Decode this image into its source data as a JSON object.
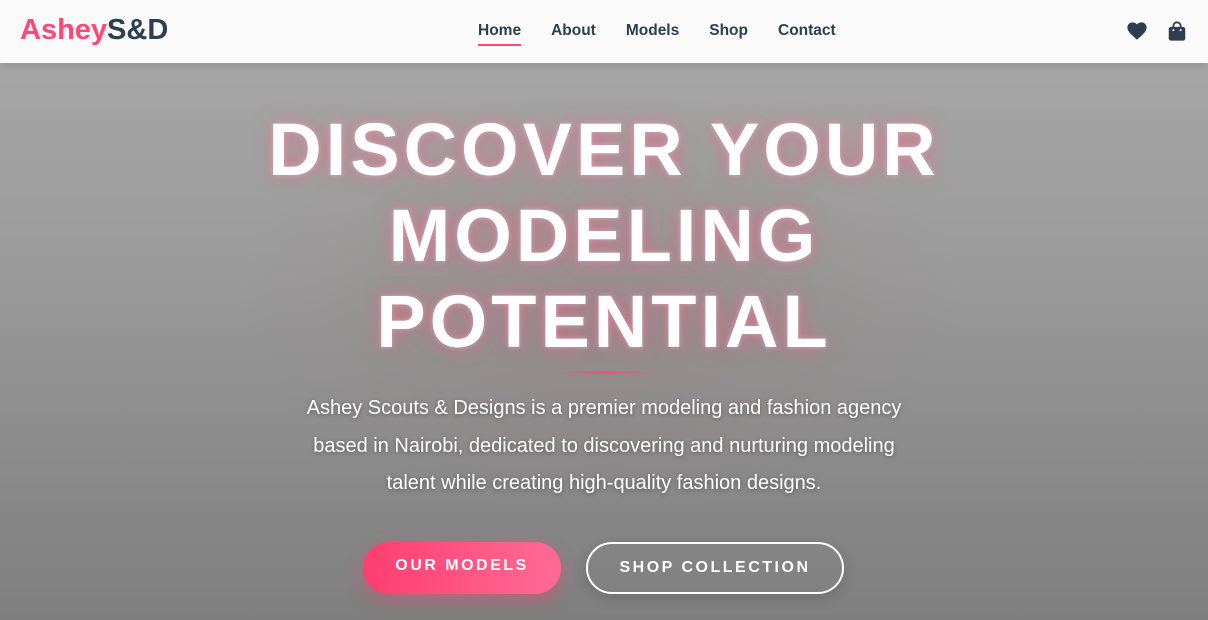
{
  "brand": {
    "part1": "Ashey",
    "part2": "S&D"
  },
  "nav": {
    "items": [
      {
        "label": "Home",
        "active": true
      },
      {
        "label": "About",
        "active": false
      },
      {
        "label": "Models",
        "active": false
      },
      {
        "label": "Shop",
        "active": false
      },
      {
        "label": "Contact",
        "active": false
      }
    ]
  },
  "header_icons": [
    "heart-icon",
    "shopping-bag-icon"
  ],
  "hero": {
    "title_lines": [
      "DISCOVER YOUR",
      "MODELING",
      "POTENTIAL"
    ],
    "description": "Ashey Scouts & Designs is a premier modeling and fashion agency based in Nairobi, dedicated to discovering and nurturing modeling talent while creating high-quality fashion designs.",
    "primary_button": "OUR MODELS",
    "secondary_button": "SHOP COLLECTION"
  },
  "colors": {
    "accent": "#ff4778",
    "dark": "#2c3e50",
    "header_bg": "#fafafa"
  }
}
